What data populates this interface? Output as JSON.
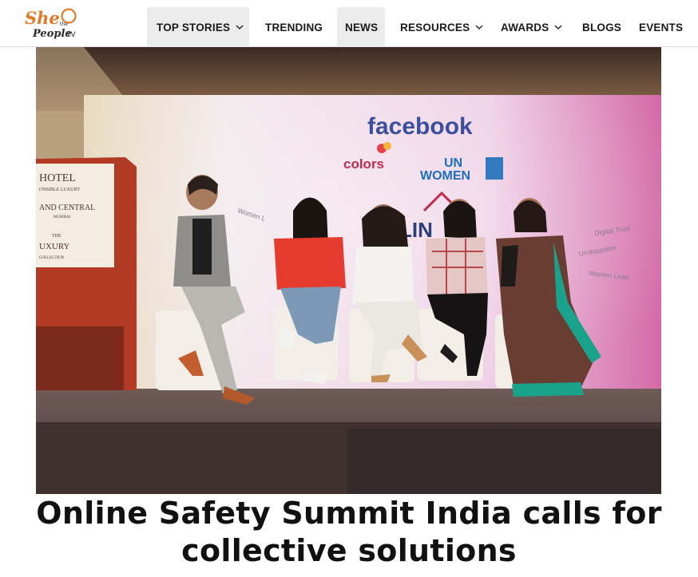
{
  "header": {
    "logo": {
      "top_text": "She",
      "small_text": "the",
      "bottom_text": "People",
      "suffix_text": "TV",
      "colors": {
        "primary": "#e07a2a",
        "dark": "#2b2b2b"
      }
    },
    "nav": [
      {
        "label": "TOP STORIES",
        "has_dropdown": true,
        "highlighted": true
      },
      {
        "label": "TRENDING",
        "has_dropdown": false,
        "highlighted": false
      },
      {
        "label": "NEWS",
        "has_dropdown": false,
        "highlighted": true
      },
      {
        "label": "RESOURCES",
        "has_dropdown": true,
        "highlighted": false
      },
      {
        "label": "AWARDS",
        "has_dropdown": true,
        "highlighted": false
      },
      {
        "label": "BLOGS",
        "has_dropdown": false,
        "highlighted": false
      },
      {
        "label": "EVENTS",
        "has_dropdown": false,
        "highlighted": false
      }
    ]
  },
  "article": {
    "image": {
      "backdrop": {
        "brand": "facebook",
        "partner_1": "colors",
        "partner_2_line_1": "UN",
        "partner_2_line_2": "WOMEN",
        "partial_title": "LIN",
        "side_words": [
          "Women L",
          "Unstoppable",
          "Digital Trust",
          "Women Lead"
        ]
      },
      "podium": {
        "lines": [
          "HOTEL",
          "ONSIBLE LUXURY",
          "AND CENTRAL",
          "MUMBAI",
          "THE",
          "UXURY",
          "COLLECTION"
        ]
      }
    },
    "title": "Online Safety Summit India calls for collective solutions"
  },
  "colors": {
    "accent": "#e07a2a",
    "nav_highlight": "#ececec",
    "text": "#111111",
    "facebook": "#3b4f9c",
    "un_women": "#1d6fb8"
  }
}
